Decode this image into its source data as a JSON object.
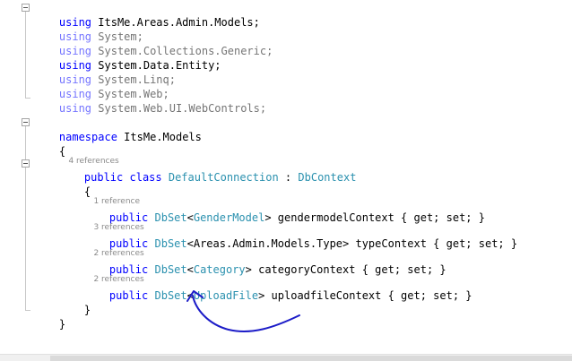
{
  "code": {
    "usings": [
      {
        "kw": "using",
        "ns": "ItsMe.Areas.Admin.Models;"
      },
      {
        "kw": "using",
        "ns": "System;"
      },
      {
        "kw": "using",
        "ns": "System.Collections.Generic;"
      },
      {
        "kw": "using",
        "ns": "System.Data.Entity;"
      },
      {
        "kw": "using",
        "ns": "System.Linq;"
      },
      {
        "kw": "using",
        "ns": "System.Web;"
      },
      {
        "kw": "using",
        "ns": "System.Web.UI.WebControls;"
      }
    ],
    "namespace_kw": "namespace",
    "namespace_name": "ItsMe.Models",
    "open_brace": "{",
    "close_brace": "}",
    "class_refs": "4 references",
    "class_public": "public",
    "class_kw": "class",
    "class_name": "DefaultConnection",
    "class_colon": ":",
    "class_base": "DbContext",
    "members": [
      {
        "refs": "1 reference",
        "public": "public",
        "dbset": "DbSet",
        "lt": "<",
        "type": "GenderModel",
        "rest": "> gendermodelContext { get; set; }"
      },
      {
        "refs": "3 references",
        "public": "public",
        "dbset": "DbSet",
        "lt": "<",
        "type": "Areas.Admin.Models.Type",
        "rest": "> typeContext { get; set; }"
      },
      {
        "refs": "2 references",
        "public": "public",
        "dbset": "DbSet",
        "lt": "<",
        "type": "Category",
        "rest": "> categoryContext { get; set; }"
      },
      {
        "refs": "2 references",
        "public": "public",
        "dbset": "DbSet",
        "lt": "<",
        "type": "UploadFile",
        "rest": "> uploadfileContext { get; set; }"
      }
    ]
  },
  "colors": {
    "keyword": "#0000ff",
    "type": "#2b91af",
    "annotation": "#1c1cc8"
  },
  "icons": [
    "collapse-icon",
    "hand-drawn-arrow"
  ]
}
